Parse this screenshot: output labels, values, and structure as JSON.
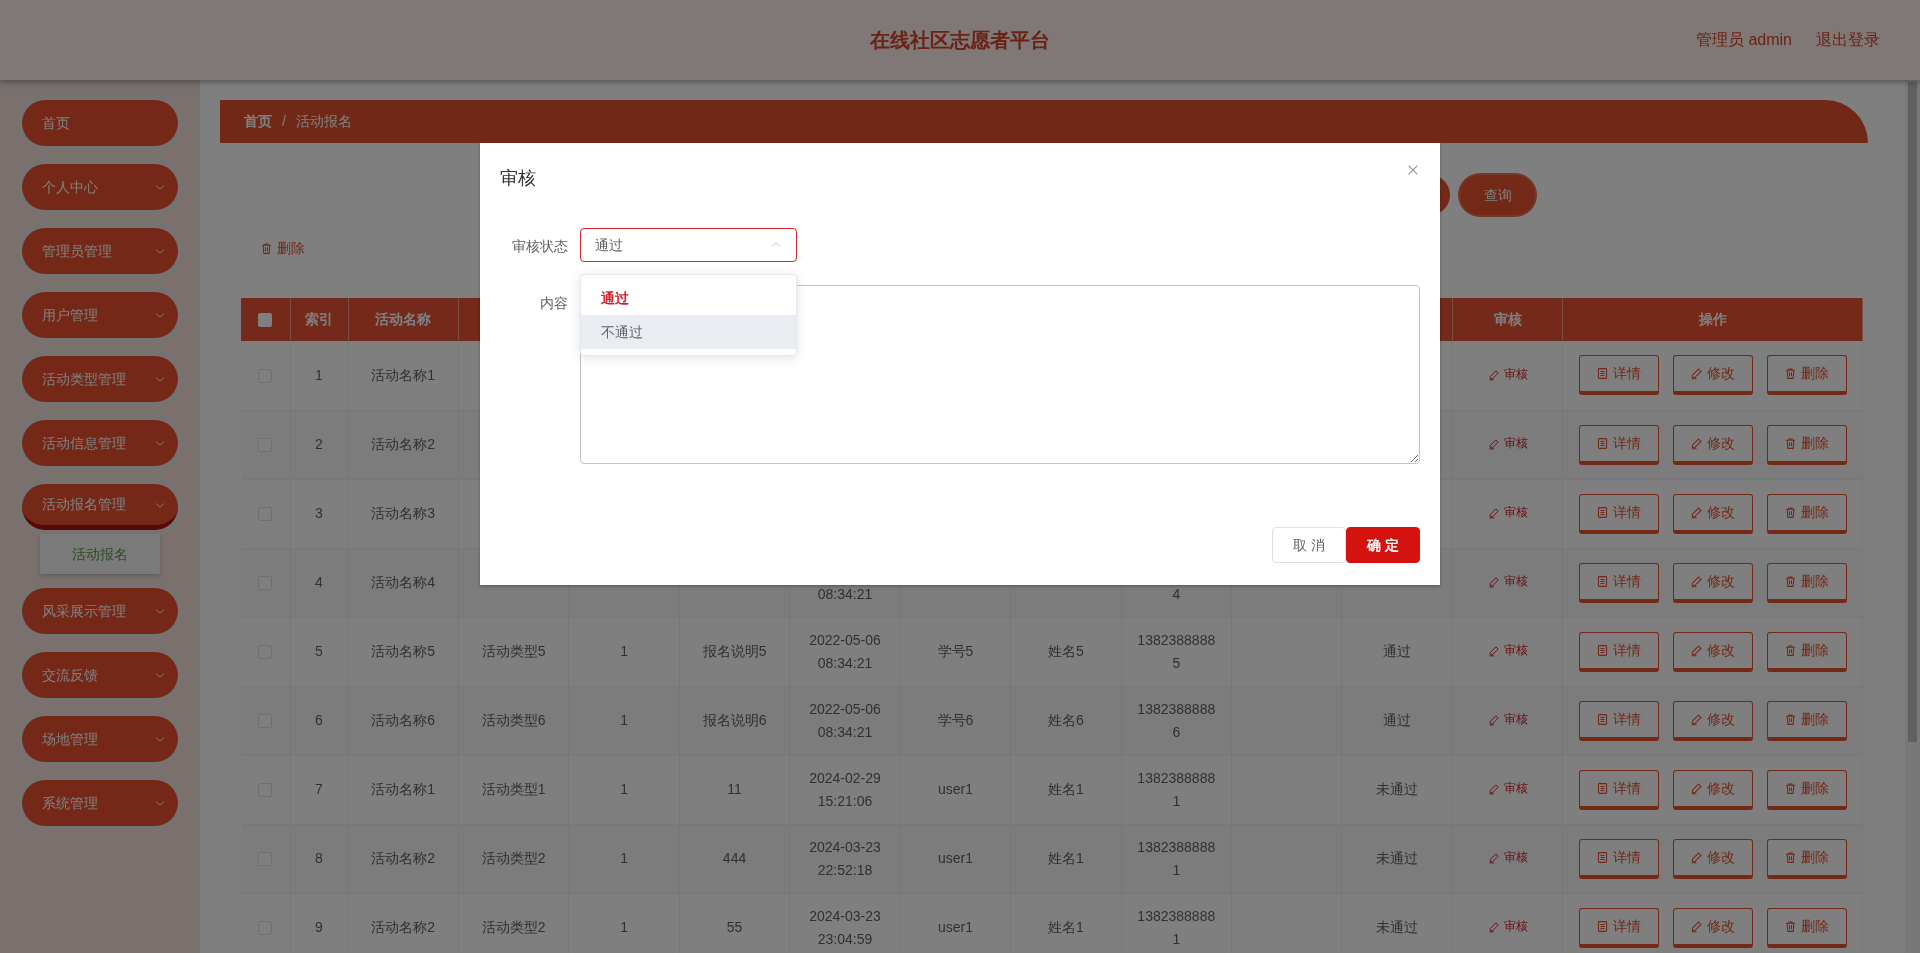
{
  "header": {
    "title": "在线社区志愿者平台",
    "user": "管理员 admin",
    "logout": "退出登录"
  },
  "sidebar": {
    "items": [
      {
        "label": "首页",
        "kind": "link",
        "expanded": false
      },
      {
        "label": "个人中心",
        "kind": "menu",
        "expanded": false
      },
      {
        "label": "管理员管理",
        "kind": "menu",
        "expanded": false
      },
      {
        "label": "用户管理",
        "kind": "menu",
        "expanded": false
      },
      {
        "label": "活动类型管理",
        "kind": "menu",
        "expanded": false
      },
      {
        "label": "活动信息管理",
        "kind": "menu",
        "expanded": false
      },
      {
        "label": "活动报名管理",
        "kind": "menu",
        "expanded": true,
        "children": [
          {
            "label": "活动报名",
            "selected": true
          }
        ]
      },
      {
        "label": "风采展示管理",
        "kind": "menu",
        "expanded": false
      },
      {
        "label": "交流反馈",
        "kind": "menu",
        "expanded": false
      },
      {
        "label": "场地管理",
        "kind": "menu",
        "expanded": false
      },
      {
        "label": "系统管理",
        "kind": "menu",
        "expanded": false
      }
    ]
  },
  "breadcrumb": [
    "首页",
    "活动报名"
  ],
  "breadcrumb_separator": "/",
  "toolbar": {
    "query_button": "查询",
    "delete_button": "删除"
  },
  "table": {
    "select_all_checked": false,
    "columns": [
      "索引",
      "活动名称",
      null,
      null,
      null,
      null,
      null,
      null,
      null,
      null,
      null,
      "审核",
      "操作"
    ],
    "rows": [
      {
        "checked": false,
        "cells": [
          [
            "1"
          ],
          [
            "活动名称1"
          ],
          null,
          null,
          null,
          null,
          null,
          null,
          null,
          null,
          null
        ],
        "audit_link": "审核",
        "actions": [
          {
            "kind": "detail",
            "label": "详情"
          },
          {
            "kind": "edit",
            "label": "修改"
          },
          {
            "kind": "delete",
            "label": "删除"
          }
        ]
      },
      {
        "checked": false,
        "cells": [
          [
            "2"
          ],
          [
            "活动名称2"
          ],
          null,
          null,
          null,
          null,
          null,
          null,
          null,
          null,
          null
        ],
        "audit_link": "审核",
        "actions": [
          {
            "kind": "detail",
            "label": "详情"
          },
          {
            "kind": "edit",
            "label": "修改"
          },
          {
            "kind": "delete",
            "label": "删除"
          }
        ]
      },
      {
        "checked": false,
        "cells": [
          [
            "3"
          ],
          [
            "活动名称3"
          ],
          null,
          null,
          null,
          null,
          null,
          null,
          null,
          null,
          null
        ],
        "audit_link": "审核",
        "actions": [
          {
            "kind": "detail",
            "label": "详情"
          },
          {
            "kind": "edit",
            "label": "修改"
          },
          {
            "kind": "delete",
            "label": "删除"
          }
        ]
      },
      {
        "checked": false,
        "cells": [
          [
            "4"
          ],
          [
            "活动名称4"
          ],
          null,
          null,
          null,
          [
            null,
            "08:34:21"
          ],
          null,
          null,
          [
            null,
            "4"
          ],
          null,
          null
        ],
        "audit_link": "审核",
        "actions": [
          {
            "kind": "detail",
            "label": "详情"
          },
          {
            "kind": "edit",
            "label": "修改"
          },
          {
            "kind": "delete",
            "label": "删除"
          }
        ]
      },
      {
        "checked": false,
        "cells": [
          [
            "5"
          ],
          [
            "活动名称5"
          ],
          [
            "活动类型5"
          ],
          [
            "1"
          ],
          [
            "报名说明5"
          ],
          [
            "2022-05-06",
            "08:34:21"
          ],
          [
            "学号5"
          ],
          [
            "姓名5"
          ],
          [
            "1382388888",
            "5"
          ],
          null,
          [
            "通过"
          ]
        ],
        "audit_link": "审核",
        "actions": [
          {
            "kind": "detail",
            "label": "详情"
          },
          {
            "kind": "edit",
            "label": "修改"
          },
          {
            "kind": "delete",
            "label": "删除"
          }
        ]
      },
      {
        "checked": false,
        "cells": [
          [
            "6"
          ],
          [
            "活动名称6"
          ],
          [
            "活动类型6"
          ],
          [
            "1"
          ],
          [
            "报名说明6"
          ],
          [
            "2022-05-06",
            "08:34:21"
          ],
          [
            "学号6"
          ],
          [
            "姓名6"
          ],
          [
            "1382388888",
            "6"
          ],
          null,
          [
            "通过"
          ]
        ],
        "audit_link": "审核",
        "actions": [
          {
            "kind": "detail",
            "label": "详情"
          },
          {
            "kind": "edit",
            "label": "修改"
          },
          {
            "kind": "delete",
            "label": "删除"
          }
        ]
      },
      {
        "checked": false,
        "cells": [
          [
            "7"
          ],
          [
            "活动名称1"
          ],
          [
            "活动类型1"
          ],
          [
            "1"
          ],
          [
            "11"
          ],
          [
            "2024-02-29",
            "15:21:06"
          ],
          [
            "user1"
          ],
          [
            "姓名1"
          ],
          [
            "1382388888",
            "1"
          ],
          null,
          [
            "未通过"
          ]
        ],
        "audit_link": "审核",
        "actions": [
          {
            "kind": "detail",
            "label": "详情"
          },
          {
            "kind": "edit",
            "label": "修改"
          },
          {
            "kind": "delete",
            "label": "删除"
          }
        ]
      },
      {
        "checked": false,
        "cells": [
          [
            "8"
          ],
          [
            "活动名称2"
          ],
          [
            "活动类型2"
          ],
          [
            "1"
          ],
          [
            "444"
          ],
          [
            "2024-03-23",
            "22:52:18"
          ],
          [
            "user1"
          ],
          [
            "姓名1"
          ],
          [
            "1382388888",
            "1"
          ],
          null,
          [
            "未通过"
          ]
        ],
        "audit_link": "审核",
        "actions": [
          {
            "kind": "detail",
            "label": "详情"
          },
          {
            "kind": "edit",
            "label": "修改"
          },
          {
            "kind": "delete",
            "label": "删除"
          }
        ]
      },
      {
        "checked": false,
        "cells": [
          [
            "9"
          ],
          [
            "活动名称2"
          ],
          [
            "活动类型2"
          ],
          [
            "1"
          ],
          [
            "55"
          ],
          [
            "2024-03-23",
            "23:04:59"
          ],
          [
            "user1"
          ],
          [
            "姓名1"
          ],
          [
            "1382388888",
            "1"
          ],
          null,
          [
            "未通过"
          ]
        ],
        "audit_link": "审核",
        "actions": [
          {
            "kind": "detail",
            "label": "详情"
          },
          {
            "kind": "edit",
            "label": "修改"
          },
          {
            "kind": "delete",
            "label": "删除"
          }
        ]
      }
    ]
  },
  "dialog": {
    "title": "审核",
    "fields": [
      {
        "kind": "select",
        "label": "审核状态",
        "value": "通过",
        "expanded": true,
        "options": [
          {
            "label": "通过",
            "selected": true,
            "hovered": false
          },
          {
            "label": "不通过",
            "selected": false,
            "hovered": true
          }
        ]
      },
      {
        "kind": "textarea",
        "label": "内容"
      }
    ],
    "buttons": [
      {
        "kind": "cancel",
        "label": "取 消"
      },
      {
        "kind": "primary",
        "label": "确 定"
      }
    ]
  }
}
